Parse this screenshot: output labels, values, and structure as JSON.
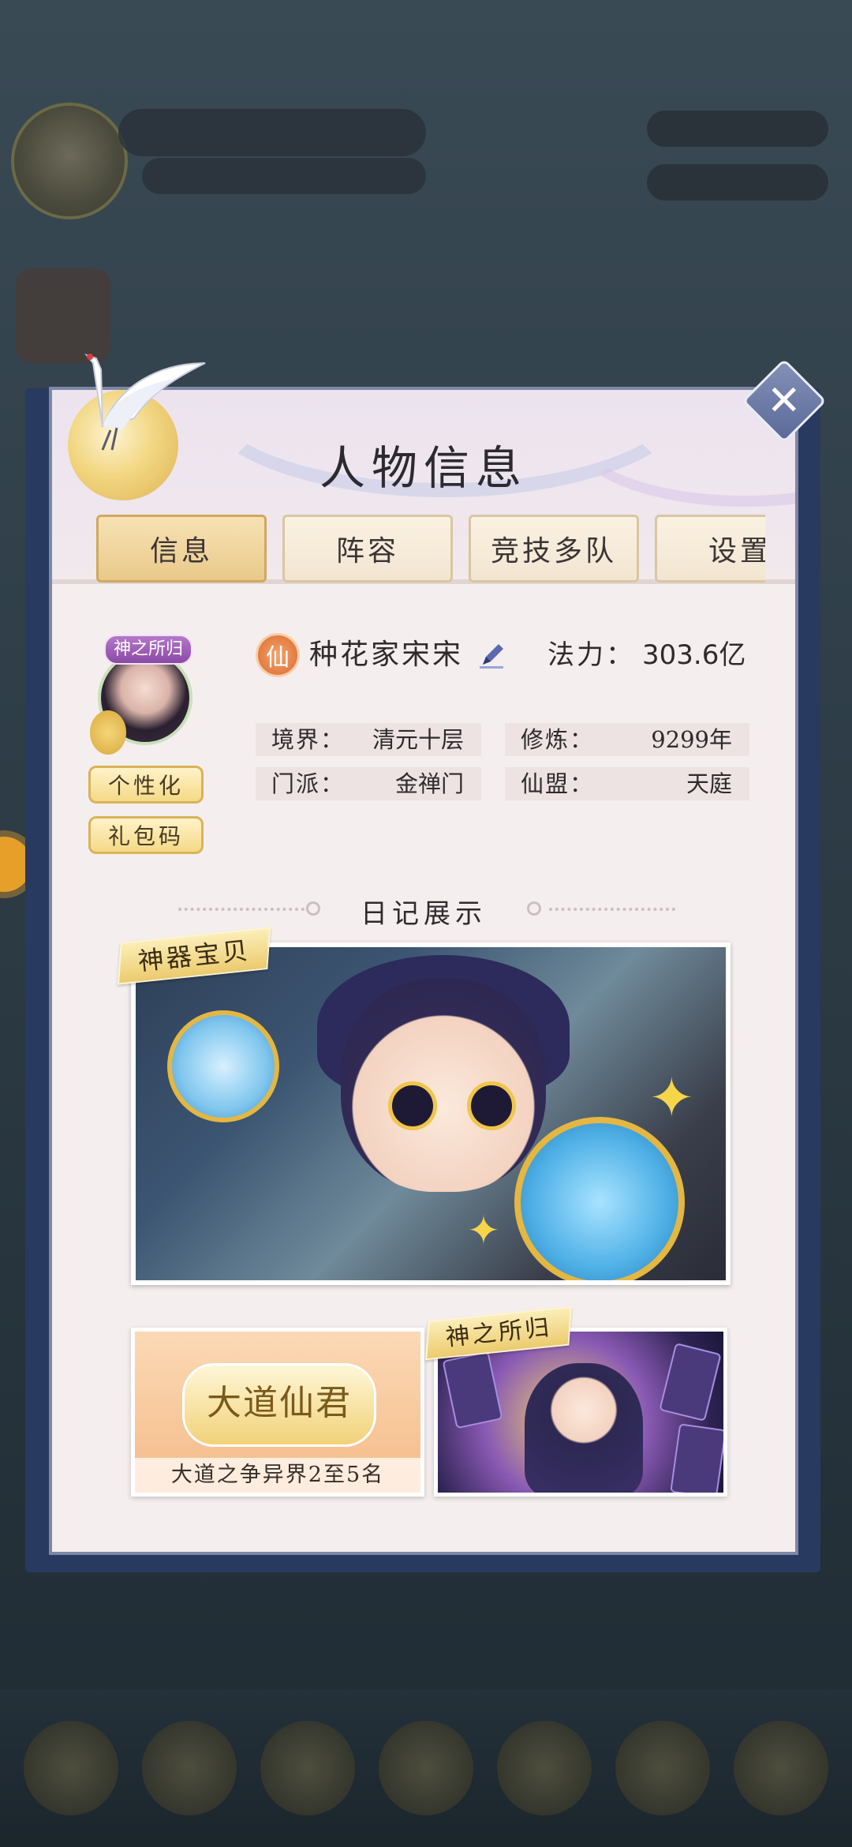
{
  "panel": {
    "title": "人物信息",
    "tabs": [
      "信息",
      "阵容",
      "竞技多队",
      "设置"
    ],
    "active_tab": "信息"
  },
  "profile": {
    "avatar_frame_label": "神之所归",
    "sect_badge": "仙",
    "name": "种花家宋宋",
    "power_label": "法力：",
    "power_value": "303.6亿",
    "fields": [
      {
        "key": "境界：",
        "value": "清元十层"
      },
      {
        "key": "修炼：",
        "value": "9299年"
      },
      {
        "key": "门派：",
        "value": "金禅门"
      },
      {
        "key": "仙盟：",
        "value": "天庭"
      }
    ],
    "buttons": {
      "personalize": "个性化",
      "gift_code": "礼包码"
    }
  },
  "diary": {
    "title": "日记展示",
    "cards": [
      {
        "label": "神器宝贝"
      },
      {
        "emblem": "大道仙君",
        "caption": "大道之争异界2至5名"
      },
      {
        "label": "神之所归"
      }
    ]
  },
  "colors": {
    "panel_bg": "#f5eeee",
    "panel_border": "#7d87a6",
    "tab_active": "#e9c98a",
    "button_gold": "#f4d987",
    "close_btn": "#6a78a6"
  },
  "icons": {
    "close": "close-icon",
    "edit": "pencil-icon",
    "sect": "xian-badge-icon"
  }
}
